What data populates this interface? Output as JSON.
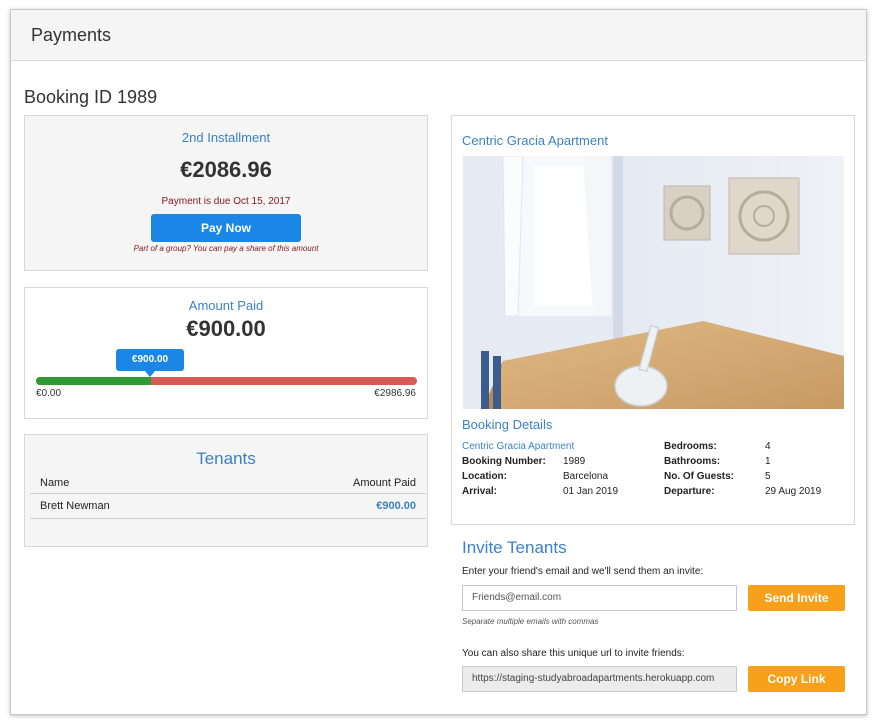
{
  "header": {
    "title": "Payments"
  },
  "booking": {
    "title": "Booking ID 1989"
  },
  "installment": {
    "label": "2nd Installment",
    "amount": "€2086.96",
    "due_text": "Payment is due Oct 15, 2017",
    "pay_button": "Pay Now",
    "group_note": "Part of a group? You can pay a share of this amount"
  },
  "amount_paid": {
    "label": "Amount Paid",
    "amount": "€900.00",
    "badge": "€900.00",
    "min_label": "€0.00",
    "max_label": "€2986.96",
    "progress_fraction": 0.301,
    "colors": {
      "paid": "#2e9b35",
      "remaining": "#d65b56"
    }
  },
  "tenants": {
    "title": "Tenants",
    "columns": [
      "Name",
      "Amount Paid"
    ],
    "rows": [
      {
        "name": "Brett Newman",
        "amount": "€900.00"
      }
    ]
  },
  "apartment": {
    "name": "Centric Gracia Apartment",
    "details_title": "Booking Details",
    "details_link": "Centric Gracia Apartment",
    "details": {
      "booking_number_label": "Booking Number:",
      "booking_number": "1989",
      "location_label": "Location:",
      "location": "Barcelona",
      "arrival_label": "Arrival:",
      "arrival": "01 Jan 2019",
      "bedrooms_label": "Bedrooms:",
      "bedrooms": "4",
      "bathrooms_label": "Bathrooms:",
      "bathrooms": "1",
      "guests_label": "No. Of Guests:",
      "guests": "5",
      "departure_label": "Departure:",
      "departure": "29 Aug 2019"
    }
  },
  "invite": {
    "title": "Invite Tenants",
    "description": "Enter your friend's email and we'll send them an invite:",
    "email_placeholder": "Friends@email.com",
    "send_button": "Send Invite",
    "hint": "Separate multiple emails with commas",
    "share_text": "You can also share this unique url to invite friends:",
    "share_url": "https://staging-studyabroadapartments.herokuapp.com",
    "copy_button": "Copy Link"
  },
  "colors": {
    "accent_blue": "#1a86e6",
    "link_blue": "#3b82c4",
    "orange": "#f9a01b"
  }
}
